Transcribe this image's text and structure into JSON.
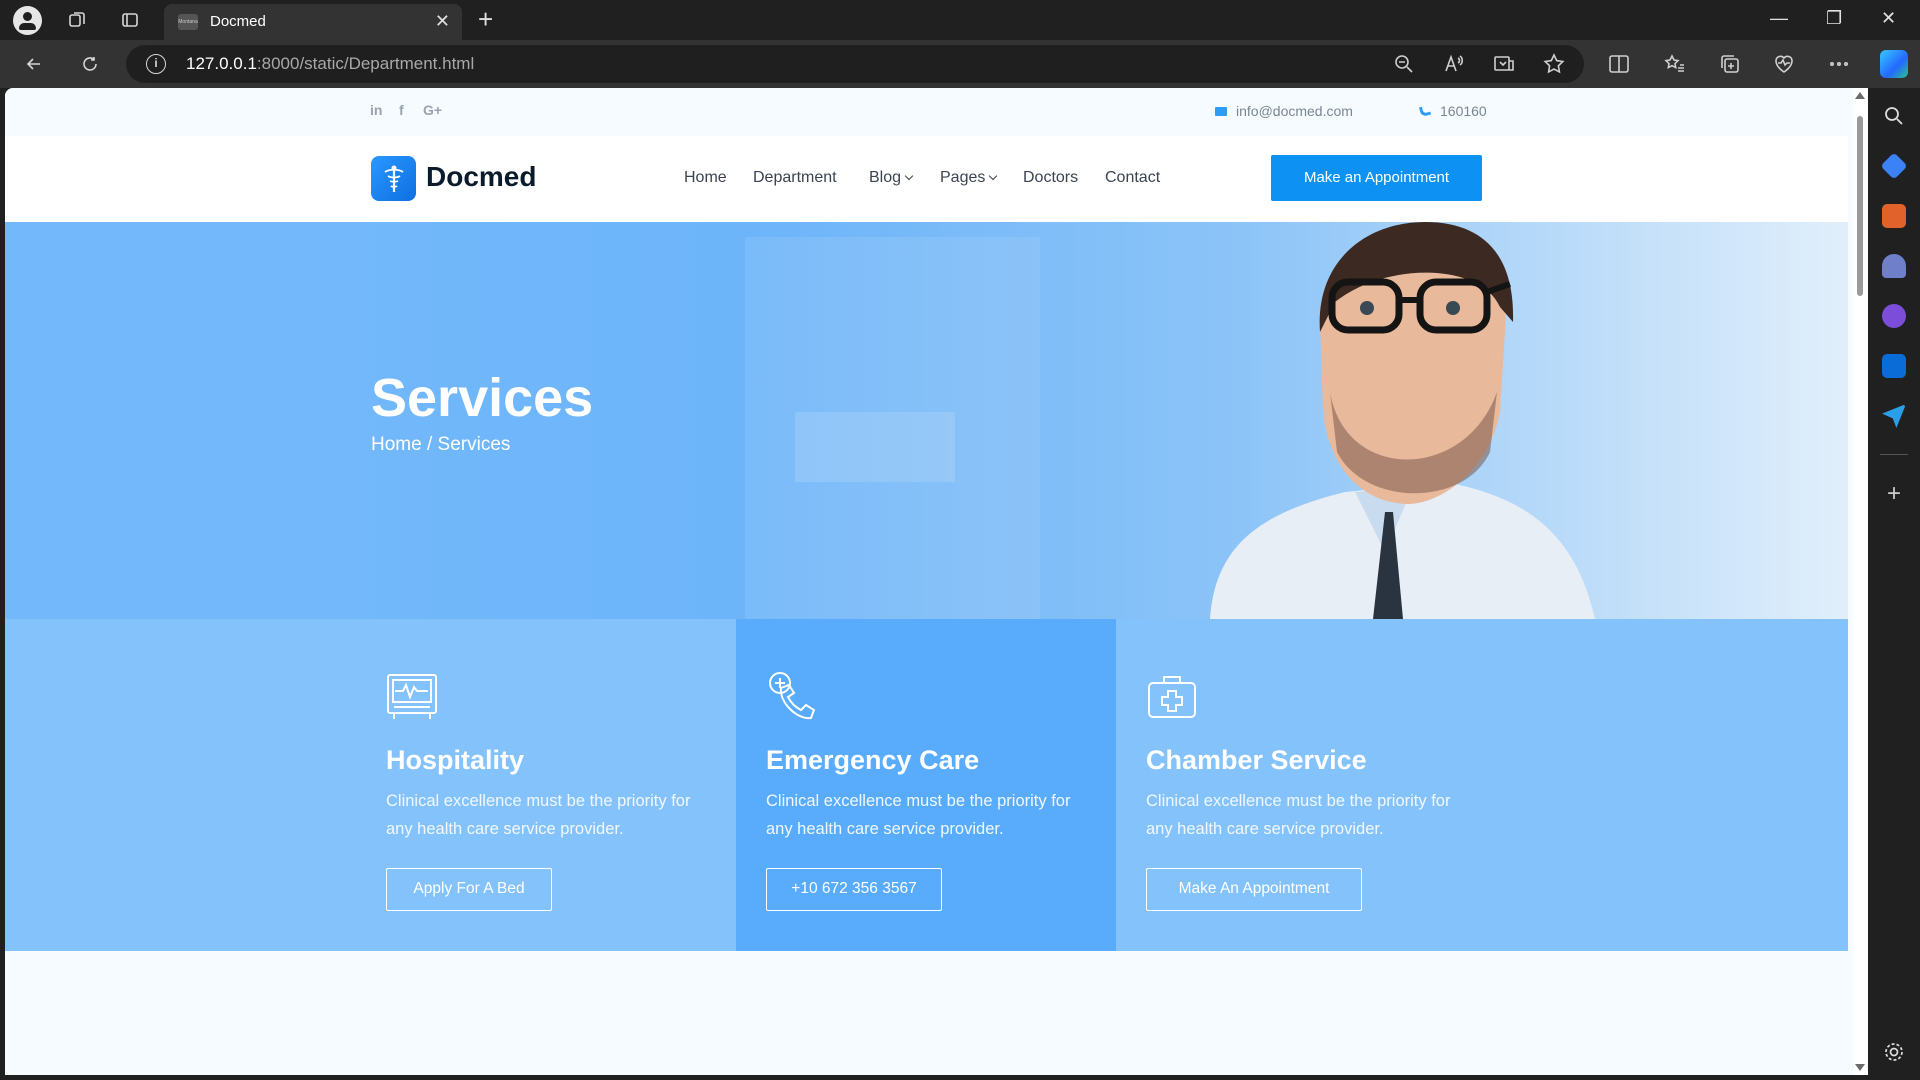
{
  "browser": {
    "tab_title": "Docmed",
    "favicon_text": "Montana",
    "url_host": "127.0.0.1",
    "url_path": ":8000/static/Department.html"
  },
  "topbar": {
    "social": [
      "in",
      "f",
      "G+"
    ],
    "email": "info@docmed.com",
    "phone": "160160"
  },
  "nav": {
    "brand": "Docmed",
    "items": [
      "Home",
      "Department",
      "Blog",
      "Pages",
      "Doctors",
      "Contact"
    ],
    "cta": "Make an Appointment"
  },
  "hero": {
    "title": "Services",
    "crumb_home": "Home",
    "crumb_sep": "/",
    "crumb_current": "Services"
  },
  "services": [
    {
      "icon": "heart-monitor-icon",
      "title": "Hospitality",
      "desc": "Clinical excellence must be the priority for any health care service provider.",
      "button": "Apply For A Bed"
    },
    {
      "icon": "phone-medical-icon",
      "title": "Emergency Care",
      "desc": "Clinical excellence must be the priority for any health care service provider.",
      "button": "+10 672 356 3567"
    },
    {
      "icon": "medical-kit-icon",
      "title": "Chamber Service",
      "desc": "Clinical excellence must be the priority for any health care service provider.",
      "button": "Make An Appointment"
    }
  ],
  "colors": {
    "accent": "#0d92f4",
    "hero_blue": "#6cb4f9",
    "service_light": "#84c2fb",
    "service_mid": "#59acfb"
  }
}
